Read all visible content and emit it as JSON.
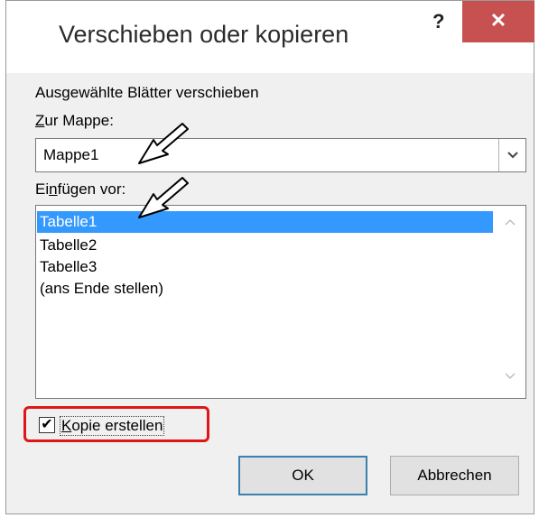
{
  "dialog": {
    "title": "Verschieben oder kopieren",
    "help": "?",
    "close": "✕"
  },
  "section_label": "Ausgewählte Blätter verschieben",
  "workbook": {
    "label_ul": "Z",
    "label_rest": "ur Mappe:",
    "value": "Mappe1",
    "dropdown_icon": "chevron-down-icon"
  },
  "insert_before": {
    "label_pre": "Ei",
    "label_ul": "n",
    "label_rest": "fügen vor:",
    "items": [
      "Tabelle1",
      "Tabelle2",
      "Tabelle3",
      "(ans Ende stellen)"
    ],
    "selected_index": 0
  },
  "copy_checkbox": {
    "checked": true,
    "check_glyph": "✔",
    "label_ul": "K",
    "label_rest": "opie erstellen"
  },
  "buttons": {
    "ok": "OK",
    "cancel": "Abbrechen"
  },
  "colors": {
    "selection": "#3399ff",
    "close_bg": "#c75050",
    "highlight_frame": "#e01515"
  }
}
